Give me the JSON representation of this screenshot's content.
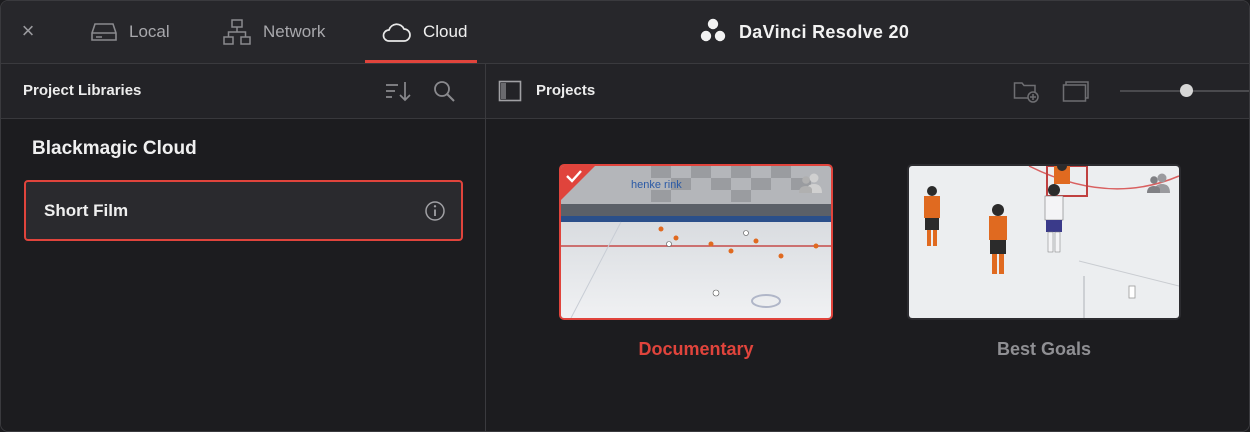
{
  "window": {
    "title": "DaVinci Resolve 20",
    "close_label": "×"
  },
  "tabs": [
    {
      "label": "Local",
      "icon": "hard-drive-icon",
      "active": false
    },
    {
      "label": "Network",
      "icon": "network-icon",
      "active": false
    },
    {
      "label": "Cloud",
      "icon": "cloud-icon",
      "active": true
    }
  ],
  "left_panel": {
    "header": "Project Libraries",
    "section_title": "Blackmagic Cloud",
    "libraries": [
      {
        "label": "Short Film",
        "selected": true
      }
    ]
  },
  "right_panel": {
    "header": "Projects",
    "projects": [
      {
        "name": "Documentary",
        "selected": true,
        "shared": true
      },
      {
        "name": "Best Goals",
        "selected": false,
        "shared": true
      }
    ]
  },
  "colors": {
    "accent": "#e0443c",
    "background": "#1c1c1f",
    "header": "#232327",
    "text": "#ececec",
    "muted": "#8f8f93"
  }
}
